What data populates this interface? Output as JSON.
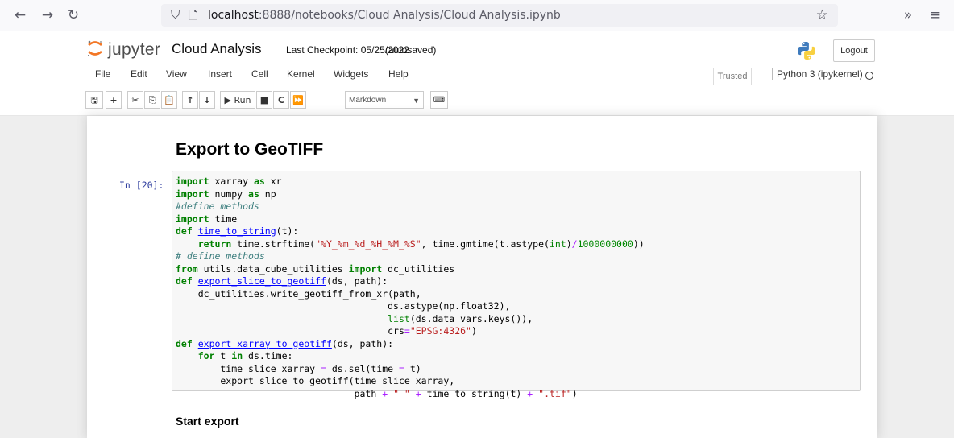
{
  "browser": {
    "back_icon": "←",
    "forward_icon": "→",
    "reload_icon": "↻",
    "url_host": "localhost",
    "url_rest": ":8888/notebooks/Cloud Analysis/Cloud Analysis.ipynb",
    "overflow_icon": "»",
    "menu_icon": "≡"
  },
  "header": {
    "logo_text": "jupyter",
    "notebook_name": "Cloud Analysis",
    "checkpoint": "Last Checkpoint: 05/25/2022",
    "autosave": "(autosaved)",
    "logout": "Logout"
  },
  "menubar": {
    "items": [
      "File",
      "Edit",
      "View",
      "Insert",
      "Cell",
      "Kernel",
      "Widgets",
      "Help"
    ],
    "trusted": "Trusted",
    "kernel": "Python 3 (ipykernel)"
  },
  "toolbar": {
    "run_label": "Run",
    "cell_type": "Markdown"
  },
  "notebook": {
    "heading": "Export to GeoTIFF",
    "prompt": "In [20]:",
    "subheading": "Start export"
  },
  "code_lines": [
    "import xarray as xr",
    "import numpy as np",
    "#define methods",
    "import time",
    "def time_to_string(t):",
    "    return time.strftime(\"%Y_%m_%d_%H_%M_%S\", time.gmtime(t.astype(int)/1000000000))",
    "# define methods",
    "from utils.data_cube_utilities import dc_utilities",
    "def export_slice_to_geotiff(ds, path):",
    "    dc_utilities.write_geotiff_from_xr(path,",
    "                                      ds.astype(np.float32),",
    "                                      list(ds.data_vars.keys()),",
    "                                      crs=\"EPSG:4326\")",
    "def export_xarray_to_geotiff(ds, path):",
    "    for t in ds.time:",
    "        time_slice_xarray = ds.sel(time = t)",
    "        export_slice_to_geotiff(time_slice_xarray,",
    "                                path + \"_\" + time_to_string(t) + \".tif\")"
  ]
}
